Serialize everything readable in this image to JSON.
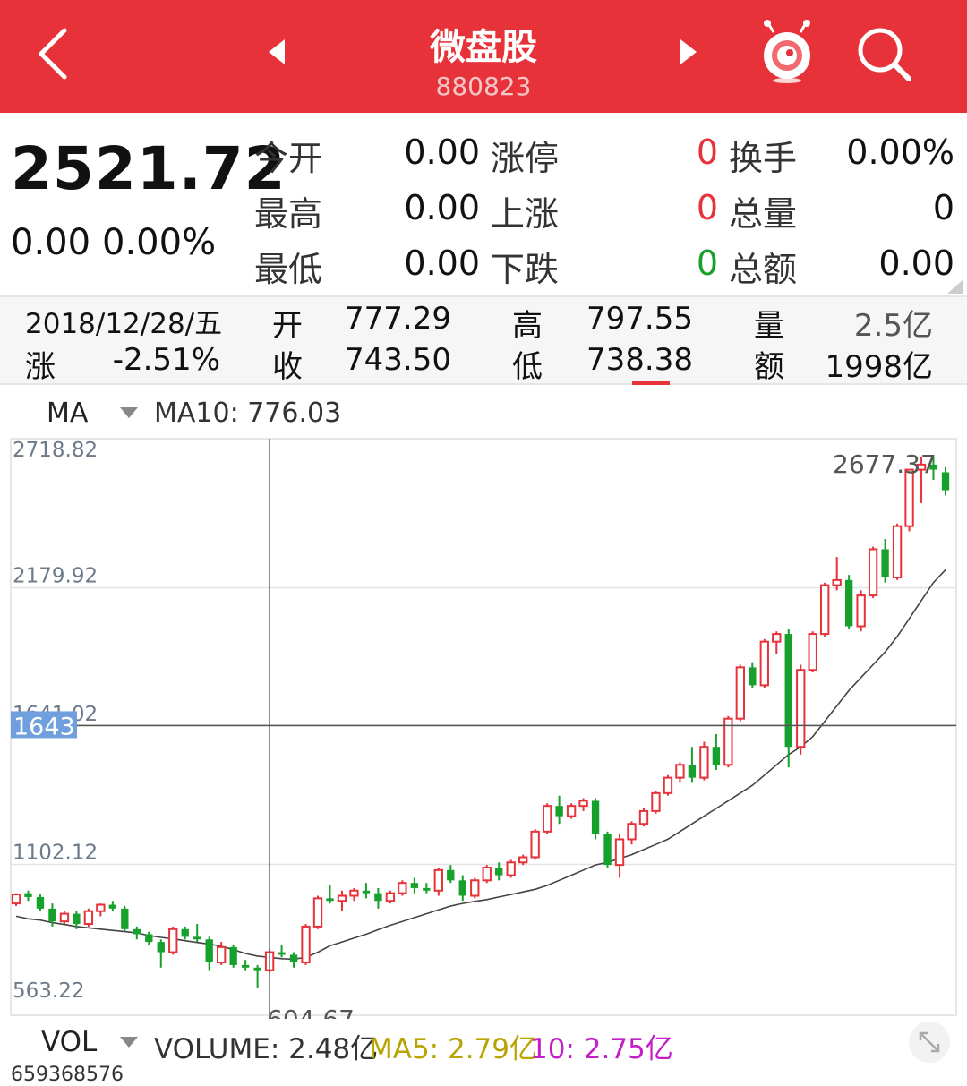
{
  "header": {
    "title": "微盘股",
    "code": "880823"
  },
  "quote": {
    "price": "2521.72",
    "change": "0.00",
    "change_pct": "0.00%",
    "rows": [
      {
        "l1": "今开",
        "v1": "0.00",
        "l2": "涨停",
        "v2": "0",
        "c2": "red",
        "l3": "换手",
        "v3": "0.00%"
      },
      {
        "l1": "最高",
        "v1": "0.00",
        "l2": "上涨",
        "v2": "0",
        "c2": "red",
        "l3": "总量",
        "v3": "0"
      },
      {
        "l1": "最低",
        "v1": "0.00",
        "l2": "下跌",
        "v2": "0",
        "c2": "green",
        "l3": "总额",
        "v3": "0.00"
      }
    ]
  },
  "detail": {
    "date": "2018/12/28/五",
    "change_label": "涨",
    "change_value": "-2.51%",
    "open_label": "开",
    "open_value": "777.29",
    "close_label": "收",
    "close_value": "743.50",
    "high_label": "高",
    "high_value": "797.55",
    "low_label": "低",
    "low_value": "738.38",
    "vol_label": "量",
    "vol_value": "2.5亿",
    "amt_label": "额",
    "amt_value": "1998亿"
  },
  "ma_bar": {
    "label": "MA",
    "value": "MA10: 776.03"
  },
  "volume_bar": {
    "label": "VOL",
    "volume": "VOLUME: 2.48亿",
    "ma5": "MA5: 2.79亿",
    "ma10": "10: 2.75亿",
    "axis_top": "659368576"
  },
  "chart_data": {
    "type": "candlestick",
    "y_ticks": [
      "2718.82",
      "2179.92",
      "1641.02",
      "1102.12",
      "563.22"
    ],
    "ylim": [
      563.22,
      2718.82
    ],
    "crosshair_value": "1643",
    "max_label": "2677.37",
    "min_label": "604.67",
    "colors": {
      "up": "#e8323a",
      "down": "#16a02c",
      "ma": "#444444"
    },
    "candles": [
      [
        950,
        990,
        940,
        985
      ],
      [
        990,
        1000,
        960,
        975
      ],
      [
        975,
        985,
        920,
        930
      ],
      [
        930,
        950,
        860,
        880
      ],
      [
        880,
        920,
        870,
        910
      ],
      [
        910,
        920,
        850,
        870
      ],
      [
        870,
        930,
        860,
        920
      ],
      [
        920,
        950,
        900,
        945
      ],
      [
        945,
        960,
        920,
        930
      ],
      [
        930,
        940,
        840,
        850
      ],
      [
        850,
        860,
        810,
        830
      ],
      [
        830,
        840,
        790,
        800
      ],
      [
        800,
        810,
        700,
        760
      ],
      [
        760,
        860,
        750,
        850
      ],
      [
        850,
        860,
        810,
        820
      ],
      [
        820,
        870,
        800,
        810
      ],
      [
        810,
        820,
        690,
        720
      ],
      [
        720,
        800,
        710,
        780
      ],
      [
        780,
        790,
        700,
        710
      ],
      [
        710,
        730,
        690,
        700
      ],
      [
        700,
        710,
        620,
        690
      ],
      [
        690,
        770,
        680,
        760
      ],
      [
        760,
        790,
        740,
        750
      ],
      [
        750,
        760,
        700,
        720
      ],
      [
        720,
        870,
        710,
        860
      ],
      [
        860,
        980,
        850,
        970
      ],
      [
        970,
        1020,
        950,
        960
      ],
      [
        960,
        1000,
        920,
        980
      ],
      [
        980,
        1010,
        960,
        1000
      ],
      [
        1000,
        1030,
        970,
        990
      ],
      [
        990,
        1010,
        930,
        960
      ],
      [
        960,
        1000,
        950,
        990
      ],
      [
        990,
        1040,
        980,
        1030
      ],
      [
        1030,
        1050,
        990,
        1010
      ],
      [
        1010,
        1030,
        990,
        1000
      ],
      [
        1000,
        1090,
        980,
        1080
      ],
      [
        1080,
        1100,
        1030,
        1040
      ],
      [
        1040,
        1060,
        960,
        980
      ],
      [
        980,
        1050,
        970,
        1040
      ],
      [
        1040,
        1100,
        1030,
        1090
      ],
      [
        1090,
        1110,
        1040,
        1060
      ],
      [
        1060,
        1120,
        1050,
        1110
      ],
      [
        1110,
        1140,
        1100,
        1130
      ],
      [
        1130,
        1240,
        1120,
        1230
      ],
      [
        1230,
        1340,
        1220,
        1330
      ],
      [
        1330,
        1370,
        1260,
        1290
      ],
      [
        1290,
        1340,
        1280,
        1330
      ],
      [
        1330,
        1360,
        1310,
        1350
      ],
      [
        1350,
        1360,
        1200,
        1220
      ],
      [
        1220,
        1230,
        1090,
        1100
      ],
      [
        1100,
        1220,
        1050,
        1200
      ],
      [
        1200,
        1270,
        1180,
        1260
      ],
      [
        1260,
        1320,
        1250,
        1310
      ],
      [
        1310,
        1390,
        1300,
        1380
      ],
      [
        1380,
        1450,
        1370,
        1440
      ],
      [
        1440,
        1500,
        1420,
        1490
      ],
      [
        1490,
        1560,
        1420,
        1440
      ],
      [
        1440,
        1580,
        1430,
        1560
      ],
      [
        1560,
        1610,
        1470,
        1490
      ],
      [
        1490,
        1680,
        1480,
        1670
      ],
      [
        1670,
        1880,
        1660,
        1870
      ],
      [
        1870,
        1890,
        1790,
        1800
      ],
      [
        1800,
        1980,
        1790,
        1970
      ],
      [
        1970,
        2010,
        1920,
        2000
      ],
      [
        2000,
        2020,
        1480,
        1560
      ],
      [
        1560,
        1880,
        1530,
        1860
      ],
      [
        1860,
        2010,
        1850,
        2000
      ],
      [
        2000,
        2200,
        1990,
        2190
      ],
      [
        2190,
        2300,
        2170,
        2210
      ],
      [
        2210,
        2230,
        2020,
        2030
      ],
      [
        2030,
        2170,
        2010,
        2150
      ],
      [
        2150,
        2340,
        2140,
        2330
      ],
      [
        2330,
        2370,
        2200,
        2220
      ],
      [
        2220,
        2430,
        2210,
        2420
      ],
      [
        2420,
        2640,
        2400,
        2640
      ],
      [
        2640,
        2690,
        2510,
        2660
      ],
      [
        2660,
        2690,
        2600,
        2640
      ],
      [
        2630,
        2650,
        2540,
        2560
      ]
    ],
    "ma10": [
      900,
      890,
      885,
      875,
      868,
      860,
      855,
      850,
      845,
      840,
      835,
      825,
      818,
      812,
      805,
      798,
      792,
      783,
      770,
      755,
      745,
      740,
      735,
      733,
      740,
      760,
      785,
      800,
      815,
      830,
      848,
      865,
      880,
      895,
      910,
      925,
      940,
      950,
      958,
      965,
      975,
      985,
      995,
      1005,
      1020,
      1040,
      1060,
      1080,
      1100,
      1110,
      1125,
      1140,
      1160,
      1180,
      1200,
      1230,
      1260,
      1290,
      1320,
      1350,
      1380,
      1410,
      1450,
      1490,
      1530,
      1560,
      1600,
      1660,
      1720,
      1780,
      1830,
      1880,
      1930,
      1990,
      2060,
      2130,
      2200,
      2250
    ]
  }
}
